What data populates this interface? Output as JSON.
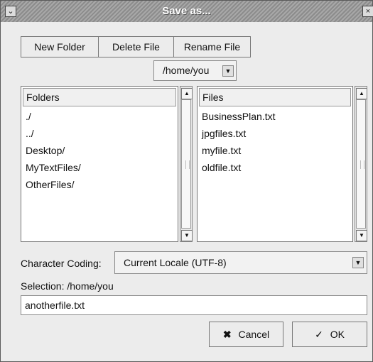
{
  "window": {
    "title": "Save as..."
  },
  "toolbar": {
    "new_folder": "New Folder",
    "delete_file": "Delete File",
    "rename_file": "Rename File"
  },
  "path_dropdown": {
    "value": "/home/you"
  },
  "folders": {
    "header": "Folders",
    "items": [
      "./",
      "../",
      "Desktop/",
      "MyTextFiles/",
      "OtherFiles/"
    ]
  },
  "files": {
    "header": "Files",
    "items": [
      "BusinessPlan.txt",
      "jpgfiles.txt",
      "myfile.txt",
      "oldfile.txt"
    ]
  },
  "coding": {
    "label": "Character Coding:",
    "value": "Current Locale (UTF-8)"
  },
  "selection": {
    "label": "Selection: /home/you",
    "value": "anotherfile.txt"
  },
  "buttons": {
    "cancel": "Cancel",
    "ok": "OK"
  },
  "icons": {
    "cancel": "cancel-icon",
    "ok": "ok-icon",
    "close": "close-icon",
    "menu": "window-menu-icon"
  }
}
